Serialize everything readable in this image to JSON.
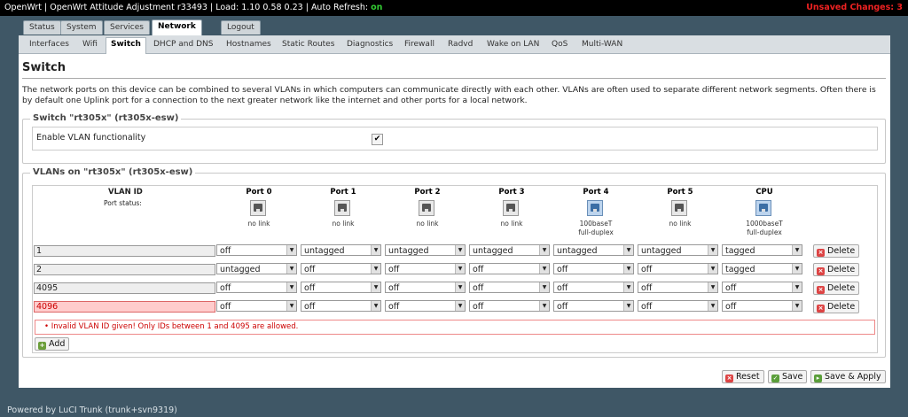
{
  "topbar": {
    "title": "OpenWrt | OpenWrt Attitude Adjustment r33493 | Load: 1.10 0.58 0.23 | Auto Refresh:",
    "auto_refresh": "on",
    "unsaved": "Unsaved Changes: 3"
  },
  "main_tabs": [
    "Status",
    "System",
    "Services",
    "Network",
    "Logout"
  ],
  "sub_tabs": [
    "Interfaces",
    "Wifi",
    "Switch",
    "DHCP and DNS",
    "Hostnames",
    "Static Routes",
    "Diagnostics",
    "Firewall",
    "Radvd",
    "Wake on LAN",
    "QoS",
    "Multi-WAN"
  ],
  "page": {
    "title": "Switch",
    "description": "The network ports on this device can be combined to several VLANs in which computers can communicate directly with each other. VLANs are often used to separate different network segments. Often there is by default one Uplink port for a connection to the next greater network like the internet and other ports for a local network."
  },
  "switch_section": {
    "legend": "Switch \"rt305x\" (rt305x-esw)",
    "enable_label": "Enable VLAN functionality",
    "enable_mark": "✔"
  },
  "vlans_section": {
    "legend": "VLANs on \"rt305x\" (rt305x-esw)",
    "vlan_id_header": "VLAN ID",
    "port_status_label": "Port status:",
    "port_headers": [
      "Port 0",
      "Port 1",
      "Port 2",
      "Port 3",
      "Port 4",
      "Port 5",
      "CPU"
    ],
    "port_status": [
      {
        "line1": "no link",
        "line2": "",
        "up": false
      },
      {
        "line1": "no link",
        "line2": "",
        "up": false
      },
      {
        "line1": "no link",
        "line2": "",
        "up": false
      },
      {
        "line1": "no link",
        "line2": "",
        "up": false
      },
      {
        "line1": "100baseT",
        "line2": "full-duplex",
        "up": true
      },
      {
        "line1": "no link",
        "line2": "",
        "up": false
      },
      {
        "line1": "1000baseT",
        "line2": "full-duplex",
        "up": true
      }
    ],
    "rows": [
      {
        "id": "1",
        "ports": [
          "off",
          "untagged",
          "untagged",
          "untagged",
          "untagged",
          "untagged",
          "tagged"
        ],
        "error": false
      },
      {
        "id": "2",
        "ports": [
          "untagged",
          "off",
          "off",
          "off",
          "off",
          "off",
          "tagged"
        ],
        "error": false
      },
      {
        "id": "4095",
        "ports": [
          "off",
          "off",
          "off",
          "off",
          "off",
          "off",
          "off"
        ],
        "error": false
      },
      {
        "id": "4096",
        "ports": [
          "off",
          "off",
          "off",
          "off",
          "off",
          "off",
          "off"
        ],
        "error": true
      }
    ],
    "delete_label": "Delete",
    "error_message": "Invalid VLAN ID given! Only IDs between 1 and 4095 are allowed.",
    "add_label": "Add"
  },
  "actions": {
    "reset": "Reset",
    "save": "Save",
    "save_apply": "Save & Apply"
  },
  "footer": "Powered by LuCI Trunk (trunk+svn9319)",
  "colors": {
    "unsaved": "#ee2222",
    "auto_refresh_on": "#33cc33",
    "error": "#cc0000",
    "background": "#3f5766"
  }
}
